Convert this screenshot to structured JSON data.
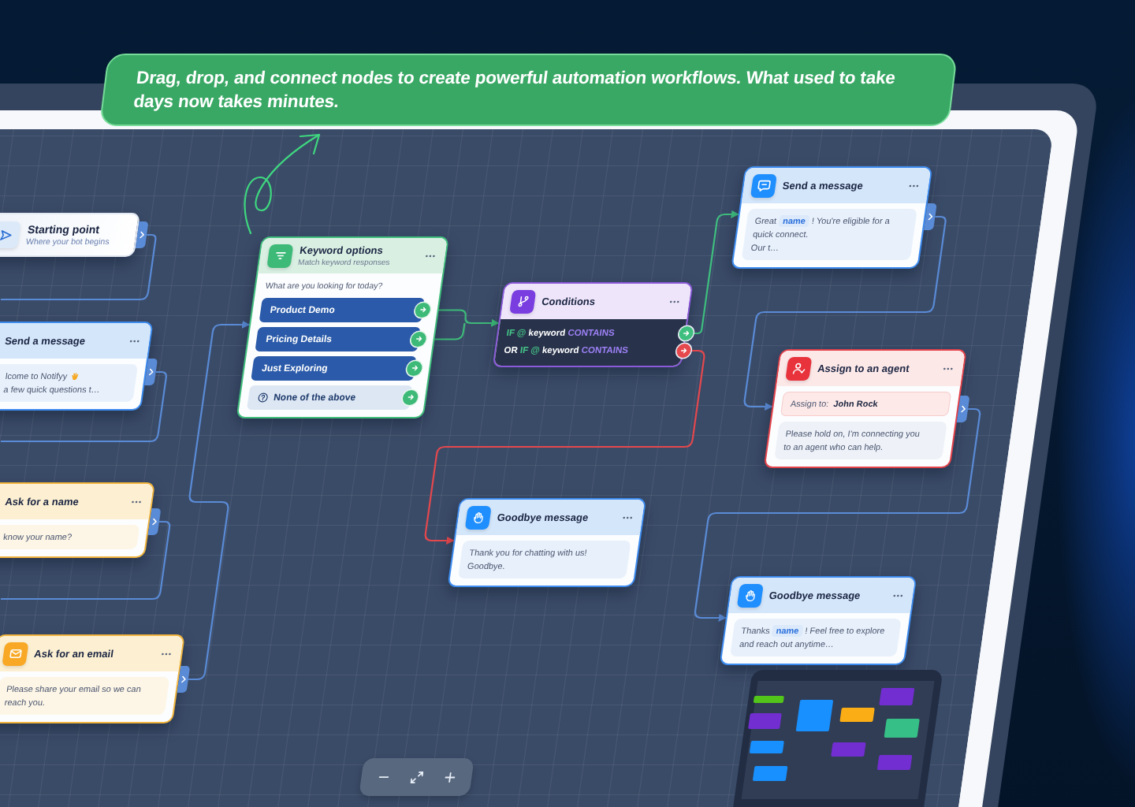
{
  "banner": {
    "text": "Drag, drop, and connect nodes to create powerful automation workflows. What used to take days now takes minutes."
  },
  "nodes": [
    {
      "kind": "start",
      "title": "Starting point",
      "subtitle": "Where your bot begins"
    },
    {
      "kind": "message",
      "title": "Send a message",
      "body": [
        [
          {
            "kind": "text",
            "text": "lcome to Notifyy"
          },
          {
            "kind": "emoji"
          }
        ],
        [
          {
            "kind": "text",
            "text": "a few quick questions t…"
          }
        ]
      ]
    },
    {
      "kind": "question",
      "title": "Ask for a name",
      "body": [
        [
          {
            "kind": "text",
            "text": "know your name?"
          }
        ]
      ]
    },
    {
      "kind": "question",
      "title": "Ask for an email",
      "body": [
        [
          {
            "kind": "text",
            "text": "Please share your email so we can reach you."
          }
        ]
      ]
    },
    {
      "kind": "keyword",
      "title": "Keyword options",
      "subtitle": "Match keyword responses",
      "prompt": "What are you looking for today?",
      "options": [
        {
          "kind": "keyword",
          "label": "Product Demo"
        },
        {
          "kind": "keyword",
          "label": "Pricing Details"
        },
        {
          "kind": "keyword",
          "label": "Just Exploring"
        },
        {
          "kind": "fallback",
          "label": "None of the above"
        }
      ]
    },
    {
      "kind": "condition",
      "title": "Conditions",
      "rules": [
        {
          "color": "#3fbf7f",
          "tokens": [
            {
              "kind": "operator",
              "text": "IF @"
            },
            {
              "kind": "field",
              "text": "keyword"
            },
            {
              "kind": "comparator",
              "text": "CONTAINS"
            }
          ]
        },
        {
          "color": "#e5484d",
          "tokens": [
            {
              "kind": "joiner",
              "text": "OR"
            },
            {
              "kind": "operator",
              "text": "IF @"
            },
            {
              "kind": "field",
              "text": "keyword"
            },
            {
              "kind": "comparator",
              "text": "CONTAINS"
            }
          ]
        }
      ]
    },
    {
      "kind": "message",
      "title": "Send a message",
      "body": [
        [
          {
            "kind": "text",
            "text": "Great"
          },
          {
            "kind": "variable",
            "text": "name"
          },
          {
            "kind": "text",
            "text": "! You're eligible for a quick connect."
          }
        ],
        [
          {
            "kind": "text",
            "text": "Our t…"
          }
        ]
      ]
    },
    {
      "kind": "agent",
      "title": "Assign to an agent",
      "assignment": {
        "label": "Assign to:",
        "value": "John Rock"
      },
      "body": [
        [
          {
            "kind": "text",
            "text": "Please hold on, I'm connecting you to an agent who can help."
          }
        ]
      ]
    },
    {
      "kind": "goodbye",
      "title": "Goodbye message",
      "body": [
        [
          {
            "kind": "text",
            "text": "Thank you for chatting with us!"
          }
        ],
        [
          {
            "kind": "text",
            "text": "Goodbye."
          }
        ]
      ]
    },
    {
      "kind": "goodbye",
      "title": "Goodbye message",
      "body": [
        [
          {
            "kind": "text",
            "text": "Thanks"
          },
          {
            "kind": "variable",
            "text": "name"
          },
          {
            "kind": "text",
            "text": "! Feel free to explore and reach out anytime…"
          }
        ]
      ]
    }
  ],
  "minimap": {
    "nodes": [
      {
        "color": "#722ed1"
      },
      {
        "color": "#52c41a"
      },
      {
        "color": "#1890ff"
      },
      {
        "color": "#faad14"
      },
      {
        "color": "#722ed1"
      },
      {
        "color": "#36c087"
      },
      {
        "color": "#1890ff"
      },
      {
        "color": "#722ed1"
      },
      {
        "color": "#722ed1"
      },
      {
        "color": "#1890ff"
      }
    ]
  }
}
